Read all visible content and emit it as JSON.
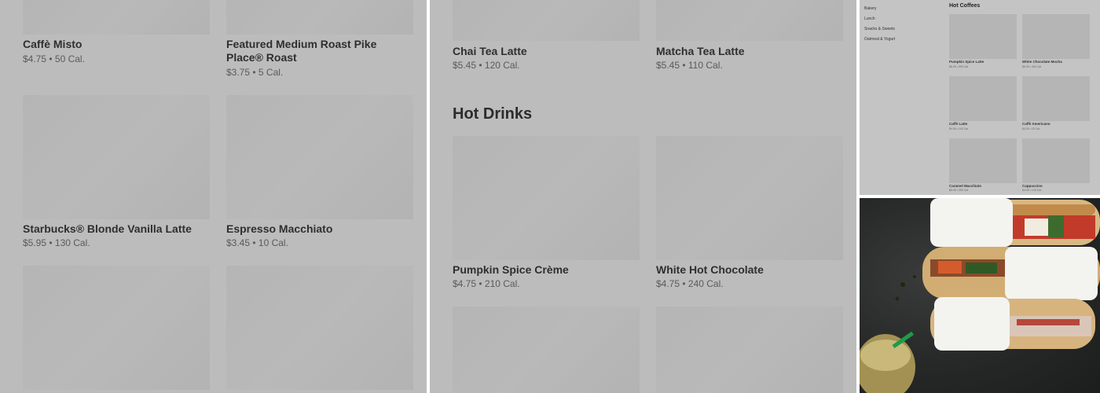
{
  "panel_a": {
    "items": [
      {
        "name": "Caffè Misto",
        "meta": "$4.75 • 50 Cal."
      },
      {
        "name": "Featured Medium Roast Pike Place® Roast",
        "meta": "$3.75 • 5 Cal."
      },
      {
        "name": "Starbucks® Blonde Vanilla Latte",
        "meta": "$5.95 • 130 Cal."
      },
      {
        "name": "Espresso Macchiato",
        "meta": "$3.45 • 10 Cal."
      }
    ]
  },
  "panel_b": {
    "items": [
      {
        "name": "Chai Tea Latte",
        "meta": "$5.45 • 120 Cal."
      },
      {
        "name": "Matcha Tea Latte",
        "meta": "$5.45 • 110 Cal."
      },
      {
        "name": "Pumpkin Spice Crème",
        "meta": "$4.75 • 210 Cal."
      },
      {
        "name": "White Hot Chocolate",
        "meta": "$4.75 • 240 Cal."
      }
    ],
    "section_title": "Hot Drinks"
  },
  "panel_c": {
    "categories": [
      "Bakery",
      "Lunch",
      "Snacks & Sweets",
      "Oatmeal & Yogurt"
    ],
    "section_title": "Hot Coffees",
    "items": [
      {
        "name": "Pumpkin Spice Latte",
        "meta": "$6.25 • 390 Cal."
      },
      {
        "name": "White Chocolate Mocha",
        "meta": "$6.25 • 430 Cal."
      },
      {
        "name": "Caffè Latte",
        "meta": "$4.95 • 190 Cal."
      },
      {
        "name": "Caffè Americano",
        "meta": "$4.25 • 15 Cal."
      },
      {
        "name": "Caramel Macchiato",
        "meta": "$5.95 • 250 Cal."
      },
      {
        "name": "Cappuccino",
        "meta": "$4.95 • 140 Cal."
      }
    ]
  },
  "colors": {
    "overlay": "#bcbcbc",
    "placeholder": "#b5b5b5",
    "photo_bg": "#2a2b2b"
  }
}
